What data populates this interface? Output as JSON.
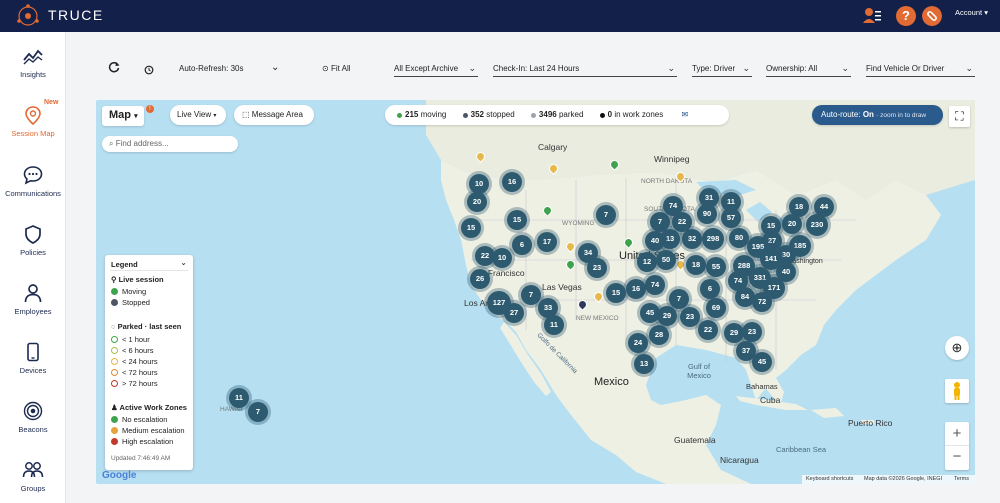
{
  "app": {
    "brand": "TRUCE",
    "account_label": "Account"
  },
  "sidebar": {
    "items": [
      {
        "label": "Insights"
      },
      {
        "label": "Session Map",
        "badge": "New",
        "active": true
      },
      {
        "label": "Communications"
      },
      {
        "label": "Policies"
      },
      {
        "label": "Employees"
      },
      {
        "label": "Devices"
      },
      {
        "label": "Beacons"
      },
      {
        "label": "Groups"
      }
    ]
  },
  "toolbar": {
    "auto_refresh": "Auto-Refresh: 30s",
    "fit_all": "Fit All",
    "filters": [
      {
        "label": "All Except Archive"
      },
      {
        "label": "Check-In: Last 24 Hours"
      },
      {
        "label": "Type: Driver"
      },
      {
        "label": "Ownership: All"
      },
      {
        "label": "Find Vehicle Or Driver"
      }
    ]
  },
  "map": {
    "view_label": "Map",
    "live_view_label": "Live View",
    "message_area_label": "Message Area",
    "search_placeholder": "Find address...",
    "stats": {
      "moving_count": "215",
      "moving_label": "moving",
      "stopped_count": "352",
      "stopped_label": "stopped",
      "parked_count": "3496",
      "parked_label": "parked",
      "workzone_count": "0",
      "workzone_label": "in work zones"
    },
    "auto_route": {
      "prefix": "Auto-route:",
      "state": "On",
      "hint": "· zoom in to draw"
    },
    "places": {
      "calgary": "Calgary",
      "winnipeg": "Winnipeg",
      "north_dakota": "NORTH DAKOTA",
      "south_dakota": "SOUTH DAKOTA",
      "wyoming": "WYOMING",
      "united_states": "United States",
      "san_francisco": "an Francisco",
      "los_angeles": "Los Angeles",
      "las_vegas": "Las Vegas",
      "new_mexico": "NEW MEXICO",
      "mexico": "Mexico",
      "gulf_of_mexico": "Gulf of Mexico",
      "guatemala": "Guatemala",
      "nicaragua": "Nicaragua",
      "cuba": "Cuba",
      "bahamas": "Bahamas",
      "puerto_rico": "Puerto Rico",
      "caribbean_sea": "Caribbean Sea",
      "hawaii": "HAWAII",
      "washington": "Washington",
      "golfo": "Golfo de California"
    },
    "clusters": [
      "10",
      "16",
      "20",
      "15",
      "15",
      "7",
      "6",
      "22",
      "10",
      "17",
      "34",
      "23",
      "26",
      "127",
      "27",
      "7",
      "33",
      "11",
      "74",
      "31",
      "11",
      "90",
      "57",
      "22",
      "7",
      "13",
      "32",
      "298",
      "80",
      "40",
      "12",
      "50",
      "18",
      "55",
      "288",
      "15",
      "16",
      "74",
      "7",
      "6",
      "69",
      "84",
      "72",
      "45",
      "29",
      "23",
      "22",
      "29",
      "23",
      "24",
      "28",
      "13",
      "37",
      "45",
      "18",
      "44",
      "20",
      "230",
      "15",
      "27",
      "185",
      "195",
      "30",
      "141",
      "40",
      "331",
      "74",
      "171",
      "11",
      "7"
    ],
    "footer": {
      "shortcuts": "Keyboard shortcuts",
      "attribution": "Map data ©2026 Google, INEGI",
      "terms": "Terms",
      "google": "Google"
    }
  },
  "legend": {
    "title": "Legend",
    "live_session_title": "Live session",
    "moving": "Moving",
    "stopped": "Stopped",
    "parked_title": "Parked · last seen",
    "p1": "< 1 hour",
    "p2": "< 6 hours",
    "p3": "< 24 hours",
    "p4": "< 72 hours",
    "p5": "> 72 hours",
    "zones_title": "Active Work Zones",
    "z1": "No escalation",
    "z2": "Medium escalation",
    "z3": "High escalation",
    "updated": "Updated 7:46:49 AM"
  },
  "colors": {
    "topbar": "#13204a",
    "accent": "#e26a33",
    "moving": "#3fa34d",
    "stopped": "#4b5563",
    "cluster": "#2e5a70",
    "autoroute": "#2b5a8c",
    "water": "#b6dff2",
    "land": "#eef0e4"
  }
}
